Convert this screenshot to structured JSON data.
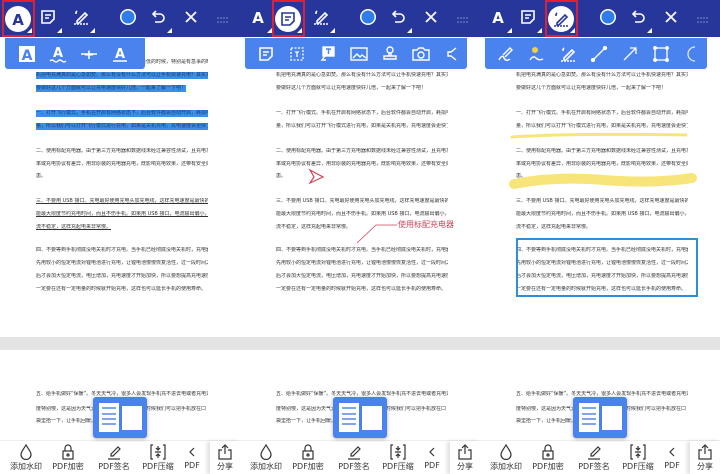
{
  "toolbar": {
    "items": [
      {
        "name": "text-markup",
        "icon": "text-a-icon"
      },
      {
        "name": "note",
        "icon": "note-icon"
      },
      {
        "name": "draw",
        "icon": "pen-icon"
      },
      {
        "name": "color",
        "icon": "color-circle-icon"
      },
      {
        "name": "undo",
        "icon": "undo-icon"
      },
      {
        "name": "close",
        "icon": "close-icon"
      },
      {
        "name": "more",
        "icon": "drag-dots-icon"
      }
    ],
    "accent": "#27369a",
    "sub_accent": "#4a82ee",
    "selection_color": "#e02030"
  },
  "panels": [
    {
      "selected_tool": "text-markup",
      "sub_tools": [
        "highlight-text",
        "squiggly-underline",
        "strikethrough",
        "underline"
      ]
    },
    {
      "selected_tool": "note",
      "sub_tools": [
        "note",
        "text-box",
        "callout",
        "image",
        "stamp",
        "camera",
        "audio"
      ]
    },
    {
      "selected_tool": "draw",
      "sub_tools": [
        "pen",
        "highlighter-pen",
        "signature-pen",
        "line",
        "arrow",
        "rectangle",
        "ellipse"
      ]
    }
  ],
  "document": {
    "lines": [
      "如今手机已成为生活中不可缺少的物品，手机电量低的时候，特别是有急事的时候，等着手",
      "机把电充满真的是心急如焚。那么有没有什么方法可以让手机快速充电？其实只",
      "要做好这几个方面就可以让充电速度快好几倍，一起来了解一下吧！",
      "一、打开飞行模式。手机在开启有网络状态下，后台软件都会自动开启，耗损电",
      "量，所以我们可以打开飞行模式进行充电，如果是关机充电，充电速度会更快了。",
      "二、使用标配充电器。由于第三方充电器和数据线未经过兼容性测试，且充电功",
      "率或充电协议有差异，用非原装的充电器充电，既影响充电效果，还带有安全隐",
      "患。",
      "三、不要用 USB 接口。充电最好使用充电头加充电线，这样充电速度是最快的，",
      "能最大限度节约充电时间，而且不伤手机。如果用 USB 接口，电流输出偏小，电",
      "流不稳定，这样充起电来非常慢。",
      "四、不要等到手机彻底没电关机时才充电。当手机已经彻底没电关机时，充电器",
      "先用较小的恒定电流对锂电池进行充电，让锂电池慢慢恢复活性，过一段时间之",
      "后才会加大恒定电流，电压增加，充电速度才开始加快，所以要想提高充电速度，",
      "一定要在还有一定电量的时候就开始充电，这样也可以延长手机的使用寿命。"
    ],
    "page2_lines": [
      "五、给手机做好“保暖”。冬天天气冷，很多人会发现手机充不进去电或者充电速",
      "度特别慢，这是因为天气太冷，电池活性降低，这时候我们可以把手机放在口",
      "袋里捂一下，让手机回暖。"
    ],
    "callout_text": "使用标配充电器",
    "highlight_color": "#3b8fe6",
    "ink_color": "#f7e57a",
    "rect_color": "#2e8fd6",
    "callout_color": "#d0455a"
  },
  "bottom_bar": {
    "items": [
      {
        "label": "添加水印",
        "icon": "watermark-drop-icon"
      },
      {
        "label": "PDF加密",
        "icon": "lock-icon"
      },
      {
        "label": "PDF签名",
        "icon": "signature-icon"
      },
      {
        "label": "PDF压缩",
        "icon": "compress-icon"
      },
      {
        "label": "PDF",
        "icon": "chevron-left-icon"
      }
    ],
    "share_label": "分享"
  }
}
